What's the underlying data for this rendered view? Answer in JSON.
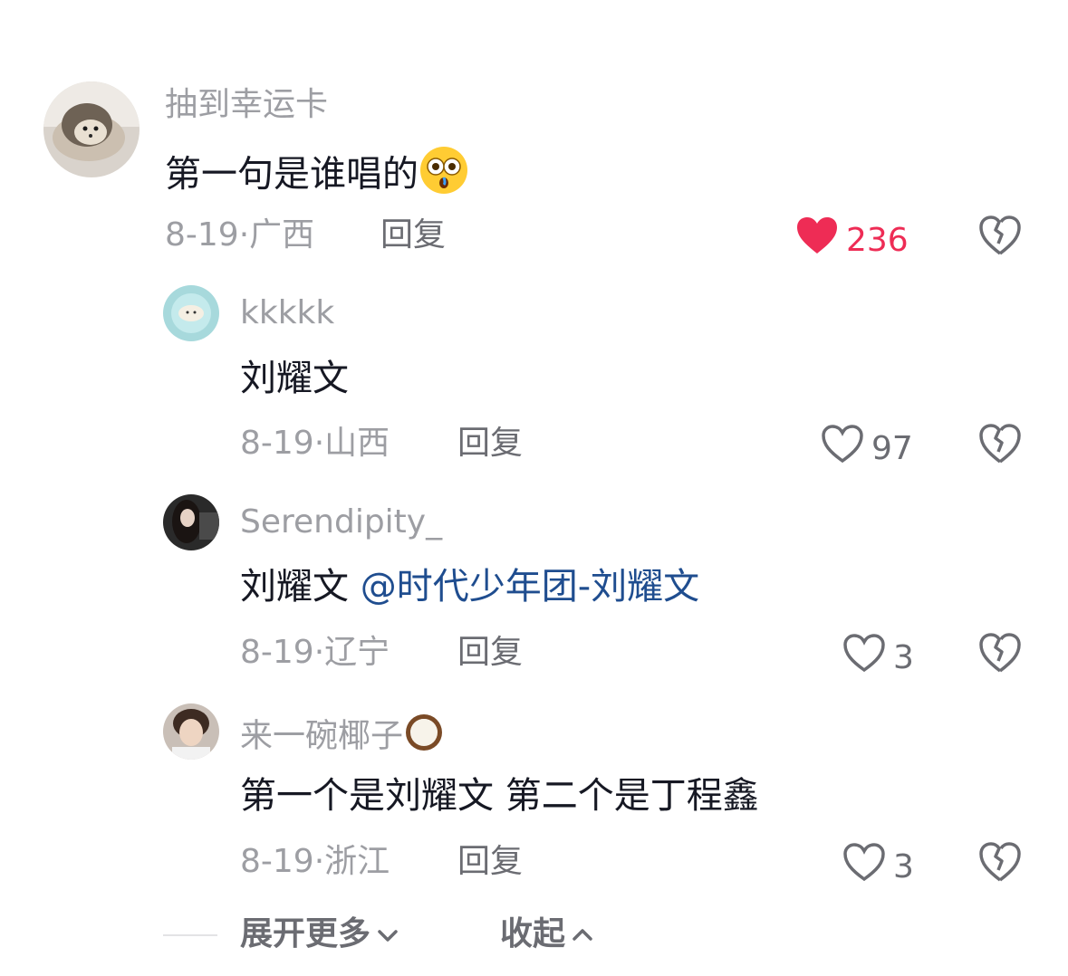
{
  "comments": [
    {
      "username": "抽到幸运卡",
      "text": "第一句是谁唱的",
      "emoji": "flushed-face",
      "date": "8-19",
      "location": "广西",
      "reply_label": "回复",
      "likes": "236",
      "liked": true
    },
    {
      "username": "kkkkk",
      "text": "刘耀文",
      "date": "8-19",
      "location": "山西",
      "reply_label": "回复",
      "likes": "97",
      "liked": false
    },
    {
      "username": "Serendipity_",
      "text": "刘耀文",
      "mention": "@时代少年团-刘耀文",
      "date": "8-19",
      "location": "辽宁",
      "reply_label": "回复",
      "likes": "3",
      "liked": false
    },
    {
      "username": "来一碗椰子",
      "username_emoji": "coconut",
      "text": "第一个是刘耀文 第二个是丁程鑫",
      "date": "8-19",
      "location": "浙江",
      "reply_label": "回复",
      "likes": "3",
      "liked": false
    }
  ],
  "footer": {
    "expand_label": "展开更多",
    "collapse_label": "收起"
  },
  "colors": {
    "liked_red": "#ee2c55",
    "mention_blue": "#1f4d8f",
    "muted_gray": "#9d9ea3"
  }
}
